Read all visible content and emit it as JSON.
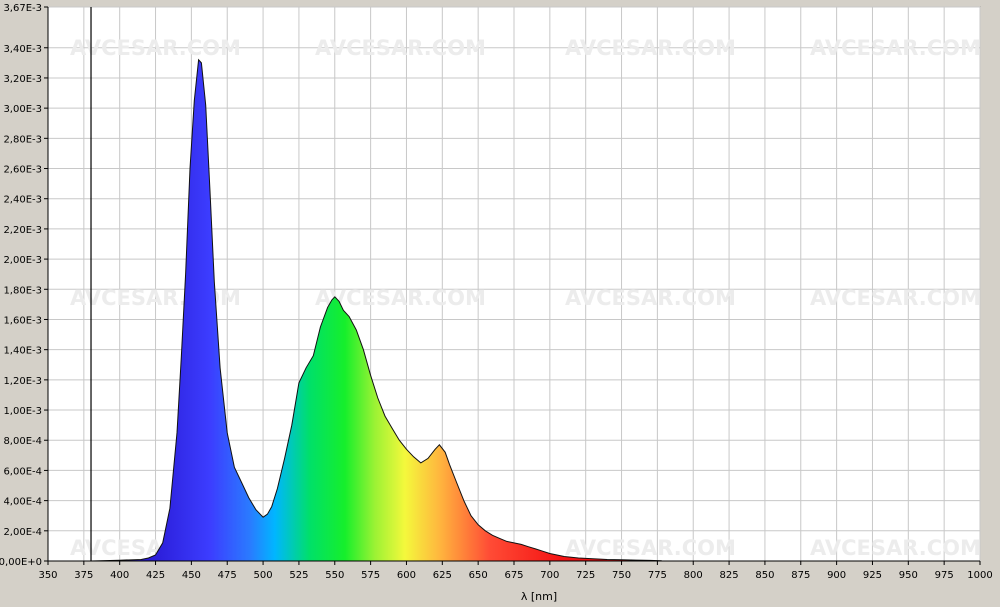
{
  "chart_data": {
    "type": "area",
    "title": "",
    "xlabel": "λ [nm]",
    "ylabel": "",
    "xlim": [
      350,
      1000
    ],
    "ylim": [
      0,
      0.00367
    ],
    "x_ticks": [
      350,
      375,
      400,
      425,
      450,
      475,
      500,
      525,
      550,
      575,
      600,
      625,
      650,
      675,
      700,
      725,
      750,
      775,
      800,
      825,
      850,
      875,
      900,
      925,
      950,
      975,
      1000
    ],
    "y_ticks": [
      {
        "value": 0.00367,
        "label": "3,67E-3"
      },
      {
        "value": 0.0034,
        "label": "3,40E-3"
      },
      {
        "value": 0.0032,
        "label": "3,20E-3"
      },
      {
        "value": 0.003,
        "label": "3,00E-3"
      },
      {
        "value": 0.0028,
        "label": "2,80E-3"
      },
      {
        "value": 0.0026,
        "label": "2,60E-3"
      },
      {
        "value": 0.0024,
        "label": "2,40E-3"
      },
      {
        "value": 0.0022,
        "label": "2,20E-3"
      },
      {
        "value": 0.002,
        "label": "2,00E-3"
      },
      {
        "value": 0.0018,
        "label": "1,80E-3"
      },
      {
        "value": 0.0016,
        "label": "1,60E-3"
      },
      {
        "value": 0.0014,
        "label": "1,40E-3"
      },
      {
        "value": 0.0012,
        "label": "1,20E-3"
      },
      {
        "value": 0.001,
        "label": "1,00E-3"
      },
      {
        "value": 0.0008,
        "label": "8,00E-4"
      },
      {
        "value": 0.0006,
        "label": "6,00E-4"
      },
      {
        "value": 0.0004,
        "label": "4,00E-4"
      },
      {
        "value": 0.0002,
        "label": "2,00E-4"
      },
      {
        "value": 0.0,
        "label": "0,00E+0"
      }
    ],
    "grid": true,
    "marker_line_x": 380,
    "series": [
      {
        "x": [
          380,
          400,
          415,
          420,
          425,
          430,
          435,
          440,
          443,
          446,
          449,
          452,
          455,
          457,
          460,
          463,
          466,
          470,
          475,
          480,
          485,
          490,
          495,
          500,
          503,
          506,
          510,
          515,
          520,
          525,
          530,
          535,
          540,
          545,
          548,
          550,
          553,
          556,
          560,
          565,
          570,
          575,
          580,
          585,
          590,
          595,
          600,
          605,
          610,
          615,
          620,
          623,
          627,
          630,
          635,
          640,
          645,
          650,
          655,
          660,
          665,
          670,
          675,
          680,
          685,
          690,
          695,
          700,
          710,
          720,
          730,
          740,
          750,
          760,
          770,
          778
        ],
        "y": [
          0.0,
          5e-06,
          1e-05,
          2e-05,
          4e-05,
          0.00012,
          0.00035,
          0.00085,
          0.00135,
          0.0019,
          0.0026,
          0.00305,
          0.00332,
          0.0033,
          0.00302,
          0.00245,
          0.00185,
          0.00128,
          0.00085,
          0.00062,
          0.00052,
          0.00042,
          0.00034,
          0.00029,
          0.00031,
          0.00036,
          0.00048,
          0.00068,
          0.0009,
          0.00118,
          0.00128,
          0.00136,
          0.00155,
          0.00168,
          0.00173,
          0.00175,
          0.00172,
          0.00166,
          0.00162,
          0.00153,
          0.0014,
          0.00123,
          0.00108,
          0.00096,
          0.00088,
          0.0008,
          0.00074,
          0.00069,
          0.00065,
          0.00068,
          0.00074,
          0.00077,
          0.00072,
          0.00064,
          0.00052,
          0.0004,
          0.0003,
          0.00024,
          0.0002,
          0.00017,
          0.00015,
          0.00013,
          0.00012,
          0.00011,
          9.5e-05,
          8e-05,
          6.5e-05,
          5e-05,
          3e-05,
          2e-05,
          1.5e-05,
          1e-05,
          8e-06,
          6e-06,
          4e-06,
          2e-06
        ]
      }
    ]
  },
  "watermark_text": "AVCESAR.COM",
  "colors": {
    "background": "#d4d0c8",
    "plot_area": "#ffffff",
    "grid": "#c8c8c8",
    "axis": "#000000"
  }
}
